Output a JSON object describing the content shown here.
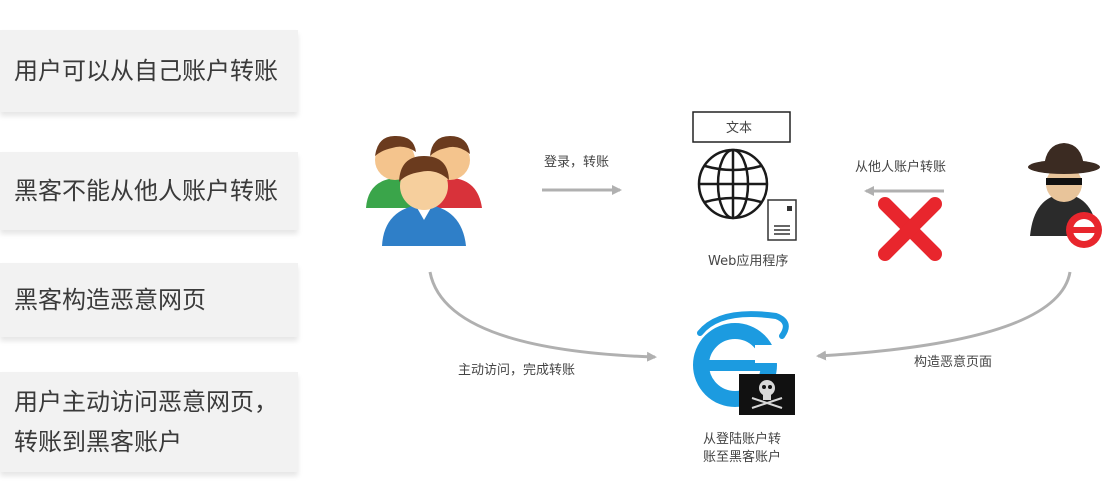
{
  "steps": [
    {
      "lines": [
        "用户可以从自己账户转账"
      ]
    },
    {
      "lines": [
        "黑客不能从他人账户转账"
      ]
    },
    {
      "lines": [
        "黑客构造恶意网页"
      ]
    },
    {
      "lines": [
        "用户主动访问恶意网页，",
        "转账到黑客账户"
      ]
    }
  ],
  "diagram": {
    "text_box_label": "文本",
    "web_app_label": "Web应用程序",
    "login_transfer_label": "登录，转账",
    "from_others_label": "从他人账户转账",
    "active_visit_label": "主动访问，完成转账",
    "construct_page_label": "构造恶意页面",
    "browser_caption_line1": "从登陆账户转",
    "browser_caption_line2": "账至黑客账户"
  },
  "colors": {
    "arrow": "#b0b0b0",
    "cross": "#e8262d",
    "user_blue": "#2f7fc8",
    "user_green": "#3aa54a",
    "user_red": "#d8323a",
    "ie_blue": "#1c9be0"
  },
  "icons": {
    "users": "users-group-icon",
    "globe": "globe-icon",
    "server": "server-icon",
    "hacker": "hacker-icon",
    "browser": "ie-browser-icon",
    "skull": "skull-icon",
    "block": "no-entry-icon",
    "cross": "red-cross-icon"
  }
}
